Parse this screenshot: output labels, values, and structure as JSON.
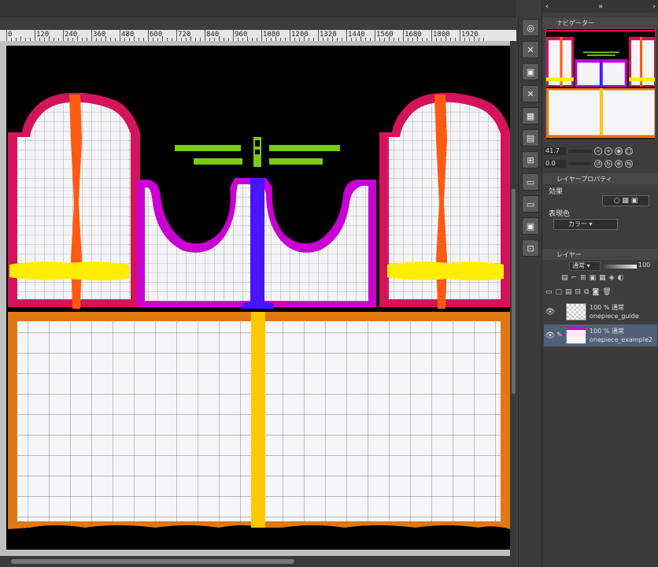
{
  "ruler": {
    "labels": [
      "0",
      "120",
      "240",
      "360",
      "480",
      "600",
      "720",
      "840",
      "960",
      "1080",
      "1200",
      "1320",
      "1440",
      "1560",
      "1680",
      "1800",
      "1920"
    ]
  },
  "tabs": {
    "collapse": "‹",
    "expand": "»",
    "menu": "||",
    "right_arrow": "›"
  },
  "navigator": {
    "title": "ナビゲーター",
    "zoom_value": "41.7",
    "rotate_value": "0.0"
  },
  "layer_properties": {
    "title": "レイヤープロパティ",
    "effect_label": "効果",
    "display_color_label": "表現色",
    "color_option": "カラー"
  },
  "layers": {
    "title": "レイヤー",
    "blend_mode": "通常",
    "opacity": "100",
    "items": [
      {
        "name": "onepiece_guide",
        "mode": "100 % 通常"
      },
      {
        "name": "onepiece_example2",
        "mode": "100 % 通常"
      }
    ]
  },
  "colors": {
    "crimson": "#d4145a",
    "orange": "#ff5a14",
    "yellow": "#ffee00",
    "purple": "#c800d2",
    "blue": "#4a14ff",
    "skirt_border": "#e07814",
    "gold": "#ffc800",
    "green": "#7acc14"
  },
  "icons": [
    "zoom-icon",
    "close-icon",
    "camera-icon",
    "grid-icon",
    "folder-icon",
    "map-icon"
  ]
}
